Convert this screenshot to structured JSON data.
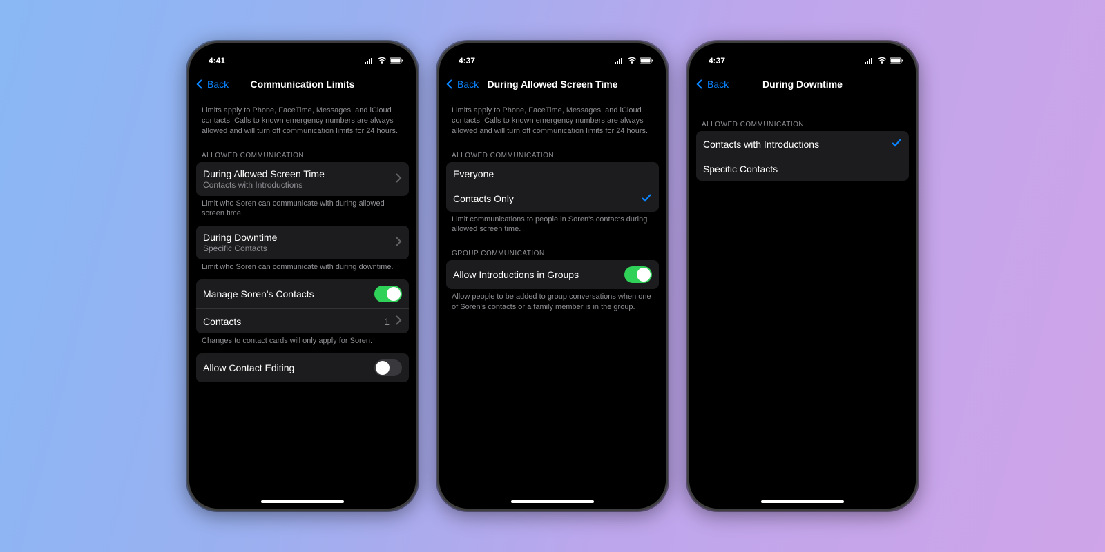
{
  "phones": [
    {
      "time": "4:41",
      "back": "Back",
      "title": "Communication Limits",
      "intro": "Limits apply to Phone, FaceTime, Messages, and iCloud contacts. Calls to known emergency numbers are always allowed and will turn off communication limits for 24 hours.",
      "allowed_header": "ALLOWED COMMUNICATION",
      "rows": {
        "r1_title": "During Allowed Screen Time",
        "r1_sub": "Contacts with Introductions",
        "r1_footer": "Limit who Soren can communicate with during allowed screen time.",
        "r2_title": "During Downtime",
        "r2_sub": "Specific Contacts",
        "r2_footer": "Limit who Soren can communicate with during downtime.",
        "r3_title": "Manage Soren's Contacts",
        "r4_title": "Contacts",
        "r4_detail": "1",
        "r4_footer": "Changes to contact cards will only apply for Soren.",
        "r5_title": "Allow Contact Editing"
      }
    },
    {
      "time": "4:37",
      "back": "Back",
      "title": "During Allowed Screen Time",
      "intro": "Limits apply to Phone, FaceTime, Messages, and iCloud contacts. Calls to known emergency numbers are always allowed and will turn off communication limits for 24 hours.",
      "allowed_header": "ALLOWED COMMUNICATION",
      "o1": "Everyone",
      "o2": "Contacts Only",
      "o2_footer": "Limit communications to people in Soren's contacts during allowed screen time.",
      "group_header": "GROUP COMMUNICATION",
      "g_title": "Allow Introductions in Groups",
      "g_footer": "Allow people to be added to group conversations when one of Soren's contacts or a family member is in the group."
    },
    {
      "time": "4:37",
      "back": "Back",
      "title": "During Downtime",
      "allowed_header": "ALLOWED COMMUNICATION",
      "o1": "Contacts with Introductions",
      "o2": "Specific Contacts"
    }
  ]
}
